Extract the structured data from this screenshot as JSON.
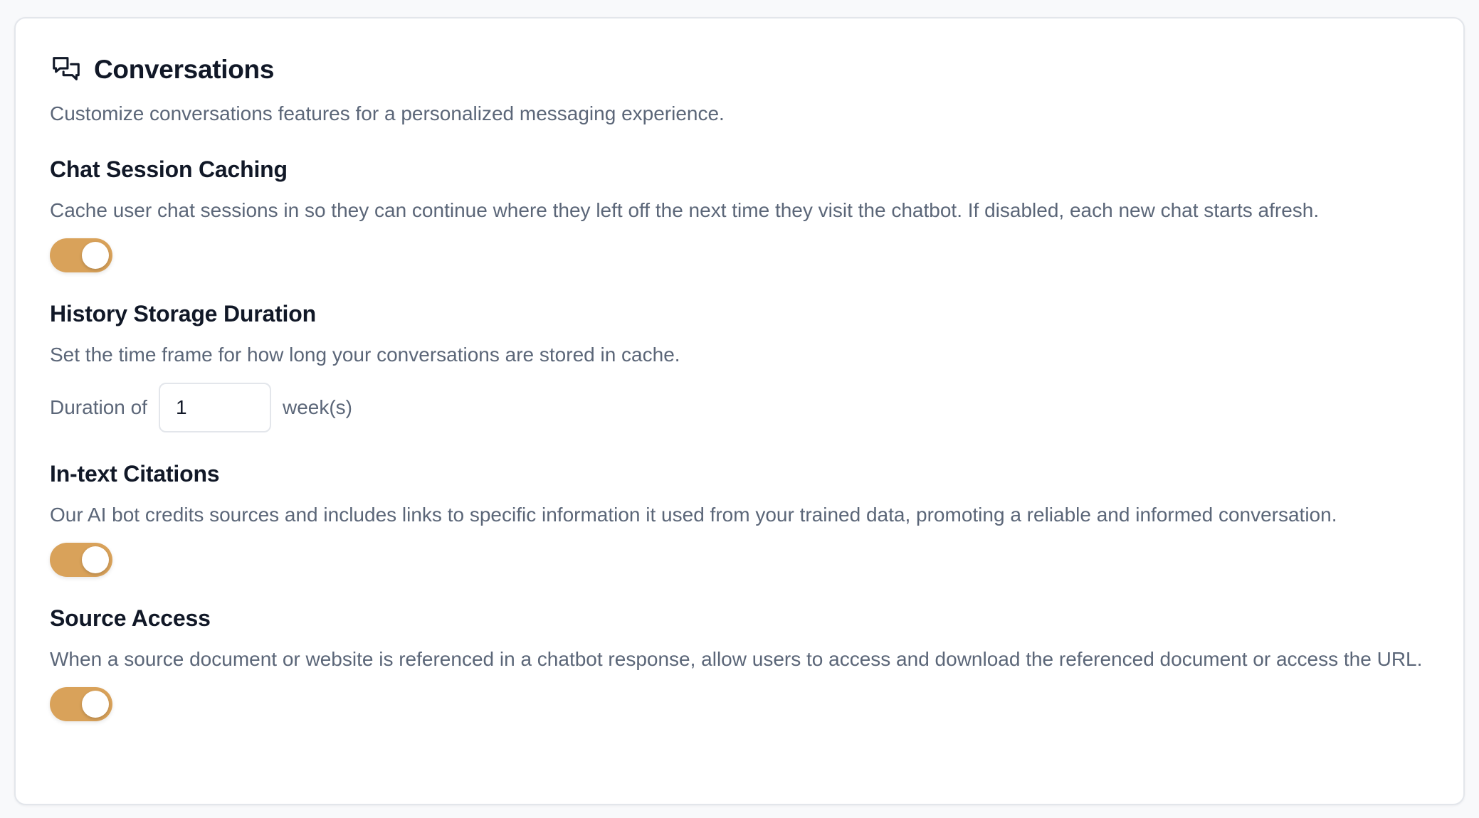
{
  "header": {
    "icon": "chat-bubbles-icon",
    "title": "Conversations",
    "subtitle": "Customize conversations features for a personalized messaging experience."
  },
  "sections": {
    "chat_session_caching": {
      "title": "Chat Session Caching",
      "description": "Cache user chat sessions in so they can continue where they left off the next time they visit the chatbot. If disabled, each new chat starts afresh.",
      "enabled": true
    },
    "history_storage_duration": {
      "title": "History Storage Duration",
      "description": "Set the time frame for how long your conversations are stored in cache.",
      "prefix_label": "Duration of",
      "value": "1",
      "unit_label": "week(s)"
    },
    "in_text_citations": {
      "title": "In-text Citations",
      "description": "Our AI bot credits sources and includes links to specific information it used from your trained data, promoting a reliable and informed conversation.",
      "enabled": true
    },
    "source_access": {
      "title": "Source Access",
      "description": "When a source document or website is referenced in a chatbot response, allow users to access and download the referenced document or access the URL.",
      "enabled": true
    }
  },
  "colors": {
    "toggle_on": "#d9a25a",
    "heading": "#111827",
    "muted_text": "#5b6678",
    "border": "#e3e6eb"
  }
}
